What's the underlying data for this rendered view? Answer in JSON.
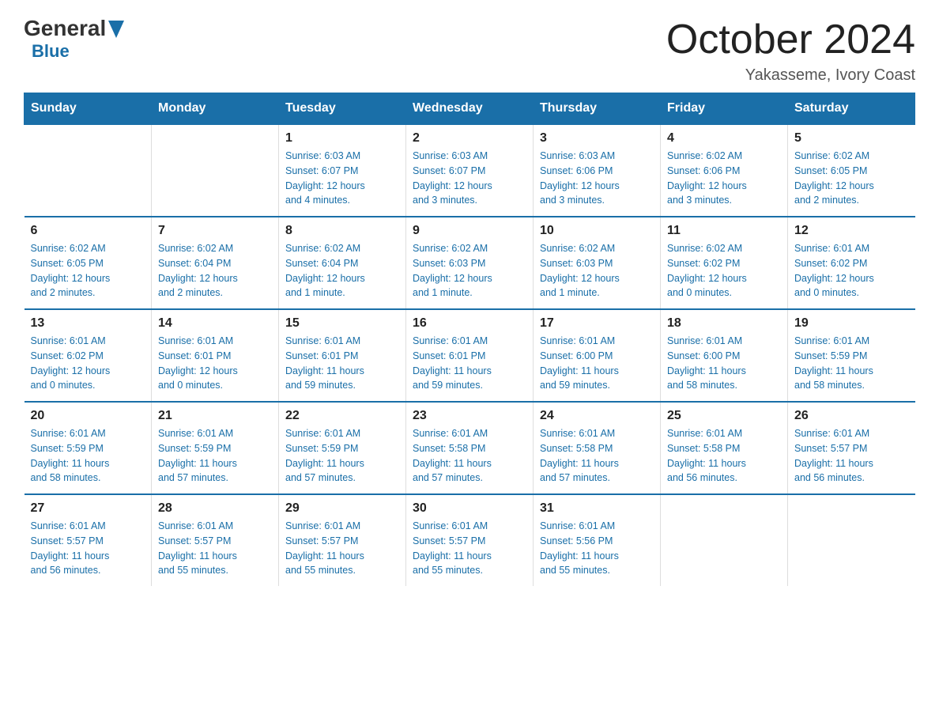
{
  "header": {
    "logo_general": "General",
    "logo_blue": "Blue",
    "title": "October 2024",
    "subtitle": "Yakasseme, Ivory Coast"
  },
  "days_of_week": [
    "Sunday",
    "Monday",
    "Tuesday",
    "Wednesday",
    "Thursday",
    "Friday",
    "Saturday"
  ],
  "weeks": [
    [
      {
        "day": "",
        "info": ""
      },
      {
        "day": "",
        "info": ""
      },
      {
        "day": "1",
        "info": "Sunrise: 6:03 AM\nSunset: 6:07 PM\nDaylight: 12 hours\nand 4 minutes."
      },
      {
        "day": "2",
        "info": "Sunrise: 6:03 AM\nSunset: 6:07 PM\nDaylight: 12 hours\nand 3 minutes."
      },
      {
        "day": "3",
        "info": "Sunrise: 6:03 AM\nSunset: 6:06 PM\nDaylight: 12 hours\nand 3 minutes."
      },
      {
        "day": "4",
        "info": "Sunrise: 6:02 AM\nSunset: 6:06 PM\nDaylight: 12 hours\nand 3 minutes."
      },
      {
        "day": "5",
        "info": "Sunrise: 6:02 AM\nSunset: 6:05 PM\nDaylight: 12 hours\nand 2 minutes."
      }
    ],
    [
      {
        "day": "6",
        "info": "Sunrise: 6:02 AM\nSunset: 6:05 PM\nDaylight: 12 hours\nand 2 minutes."
      },
      {
        "day": "7",
        "info": "Sunrise: 6:02 AM\nSunset: 6:04 PM\nDaylight: 12 hours\nand 2 minutes."
      },
      {
        "day": "8",
        "info": "Sunrise: 6:02 AM\nSunset: 6:04 PM\nDaylight: 12 hours\nand 1 minute."
      },
      {
        "day": "9",
        "info": "Sunrise: 6:02 AM\nSunset: 6:03 PM\nDaylight: 12 hours\nand 1 minute."
      },
      {
        "day": "10",
        "info": "Sunrise: 6:02 AM\nSunset: 6:03 PM\nDaylight: 12 hours\nand 1 minute."
      },
      {
        "day": "11",
        "info": "Sunrise: 6:02 AM\nSunset: 6:02 PM\nDaylight: 12 hours\nand 0 minutes."
      },
      {
        "day": "12",
        "info": "Sunrise: 6:01 AM\nSunset: 6:02 PM\nDaylight: 12 hours\nand 0 minutes."
      }
    ],
    [
      {
        "day": "13",
        "info": "Sunrise: 6:01 AM\nSunset: 6:02 PM\nDaylight: 12 hours\nand 0 minutes."
      },
      {
        "day": "14",
        "info": "Sunrise: 6:01 AM\nSunset: 6:01 PM\nDaylight: 12 hours\nand 0 minutes."
      },
      {
        "day": "15",
        "info": "Sunrise: 6:01 AM\nSunset: 6:01 PM\nDaylight: 11 hours\nand 59 minutes."
      },
      {
        "day": "16",
        "info": "Sunrise: 6:01 AM\nSunset: 6:01 PM\nDaylight: 11 hours\nand 59 minutes."
      },
      {
        "day": "17",
        "info": "Sunrise: 6:01 AM\nSunset: 6:00 PM\nDaylight: 11 hours\nand 59 minutes."
      },
      {
        "day": "18",
        "info": "Sunrise: 6:01 AM\nSunset: 6:00 PM\nDaylight: 11 hours\nand 58 minutes."
      },
      {
        "day": "19",
        "info": "Sunrise: 6:01 AM\nSunset: 5:59 PM\nDaylight: 11 hours\nand 58 minutes."
      }
    ],
    [
      {
        "day": "20",
        "info": "Sunrise: 6:01 AM\nSunset: 5:59 PM\nDaylight: 11 hours\nand 58 minutes."
      },
      {
        "day": "21",
        "info": "Sunrise: 6:01 AM\nSunset: 5:59 PM\nDaylight: 11 hours\nand 57 minutes."
      },
      {
        "day": "22",
        "info": "Sunrise: 6:01 AM\nSunset: 5:59 PM\nDaylight: 11 hours\nand 57 minutes."
      },
      {
        "day": "23",
        "info": "Sunrise: 6:01 AM\nSunset: 5:58 PM\nDaylight: 11 hours\nand 57 minutes."
      },
      {
        "day": "24",
        "info": "Sunrise: 6:01 AM\nSunset: 5:58 PM\nDaylight: 11 hours\nand 57 minutes."
      },
      {
        "day": "25",
        "info": "Sunrise: 6:01 AM\nSunset: 5:58 PM\nDaylight: 11 hours\nand 56 minutes."
      },
      {
        "day": "26",
        "info": "Sunrise: 6:01 AM\nSunset: 5:57 PM\nDaylight: 11 hours\nand 56 minutes."
      }
    ],
    [
      {
        "day": "27",
        "info": "Sunrise: 6:01 AM\nSunset: 5:57 PM\nDaylight: 11 hours\nand 56 minutes."
      },
      {
        "day": "28",
        "info": "Sunrise: 6:01 AM\nSunset: 5:57 PM\nDaylight: 11 hours\nand 55 minutes."
      },
      {
        "day": "29",
        "info": "Sunrise: 6:01 AM\nSunset: 5:57 PM\nDaylight: 11 hours\nand 55 minutes."
      },
      {
        "day": "30",
        "info": "Sunrise: 6:01 AM\nSunset: 5:57 PM\nDaylight: 11 hours\nand 55 minutes."
      },
      {
        "day": "31",
        "info": "Sunrise: 6:01 AM\nSunset: 5:56 PM\nDaylight: 11 hours\nand 55 minutes."
      },
      {
        "day": "",
        "info": ""
      },
      {
        "day": "",
        "info": ""
      }
    ]
  ]
}
